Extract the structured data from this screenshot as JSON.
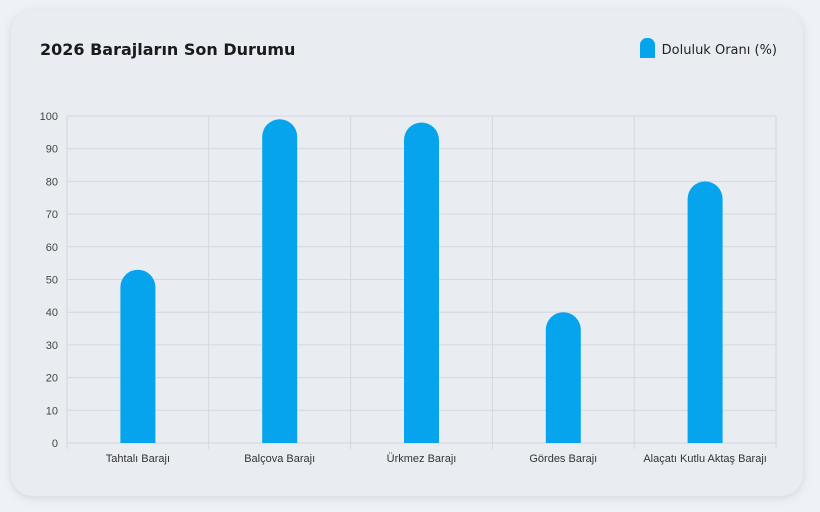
{
  "chart_data": {
    "type": "bar",
    "title": "2026 Barajların Son Durumu",
    "categories": [
      "Tahtalı Barajı",
      "Balçova Barajı",
      "Ürkmez Barajı",
      "Gördes Barajı",
      "Alaçatı Kutlu Aktaş Barajı"
    ],
    "series": [
      {
        "name": "Doluluk Oranı (%)",
        "values": [
          53,
          99,
          98,
          40,
          80
        ]
      }
    ],
    "ylim": [
      0,
      100
    ],
    "yticks": [
      0,
      10,
      20,
      30,
      40,
      50,
      60,
      70,
      80,
      90,
      100
    ],
    "xlabel": "",
    "ylabel": "",
    "grid": true,
    "legend_position": "top-right",
    "bar_color": "#05a4ec",
    "grid_color": "#d3d8df"
  }
}
